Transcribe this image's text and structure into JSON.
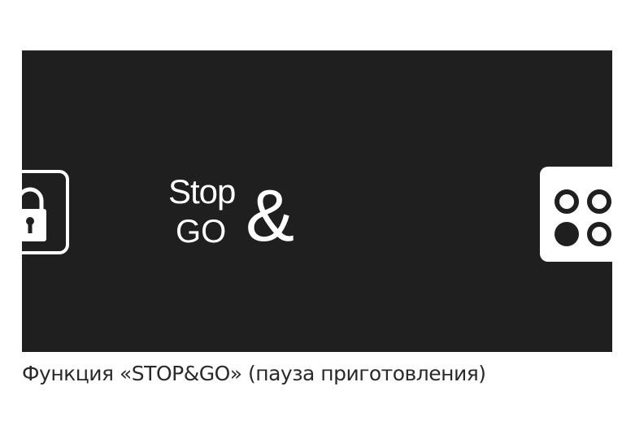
{
  "display_panel": {
    "background_color": "#1f1f1f",
    "icon_color": "#ffffff",
    "left_icon": "lock-icon",
    "center_label": {
      "line1": "Stop",
      "line2": "GO",
      "symbol": "&"
    },
    "right_icon": "keypad-grid-icon"
  },
  "caption": {
    "text": "Функция «STOP&GO» (пауза приготовления)"
  }
}
